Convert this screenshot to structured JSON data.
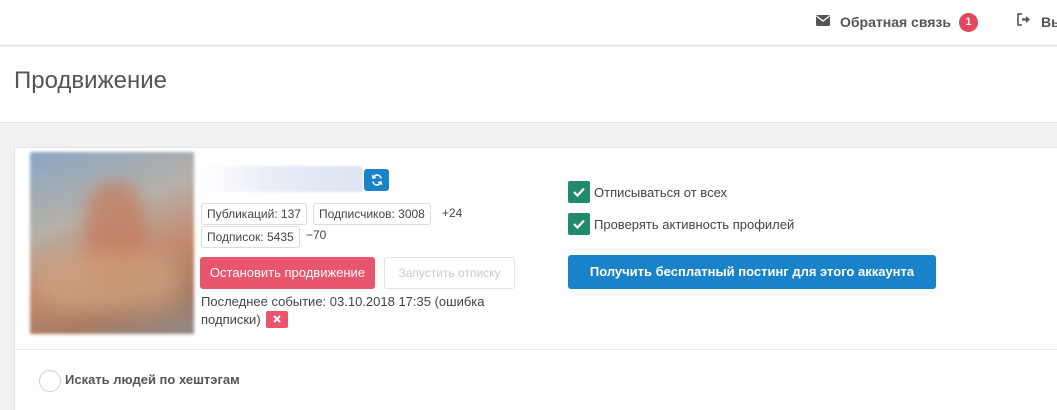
{
  "topbar": {
    "feedback_label": "Обратная связь",
    "feedback_count": "1",
    "logout_label": "Выход"
  },
  "page": {
    "title": "Продвижение"
  },
  "account": {
    "stats": {
      "publications": "Публикаций: 137",
      "followers": "Подписчиков: 3008",
      "followers_delta": "+24",
      "following": "Подписок: 5435",
      "following_delta": "−70"
    },
    "stop_button": "Остановить продвижение",
    "unfollow_button": "Запустить отписку",
    "last_event": "Последнее событие: 03.10.2018 17:35 (ошибка подписки)"
  },
  "options": {
    "unfollow_all": "Отписываться от всех",
    "check_activity": "Проверять активность профилей",
    "free_posting_button": "Получить бесплатный постинг для этого аккаунта"
  },
  "hashtag_search": {
    "label": "Искать людей по хештэгам"
  },
  "colors": {
    "accent_blue": "#1a82c8",
    "danger_red": "#e8566e",
    "check_green": "#1f8a6e",
    "badge_red": "#e2475f"
  }
}
